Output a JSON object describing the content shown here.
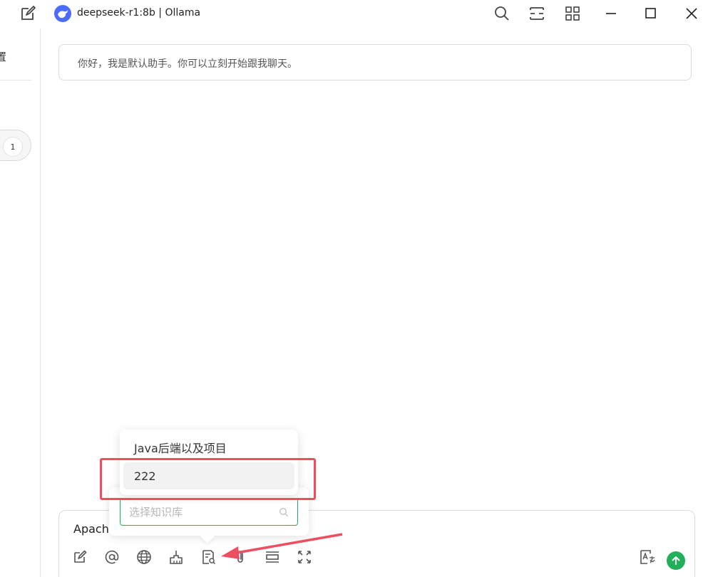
{
  "titlebar": {
    "title": "deepseek-r1:8b | Ollama",
    "icons": [
      "edit-icon",
      "deepseek-logo",
      "search-icon",
      "layout-icon",
      "grid-icon",
      "minimize-icon",
      "maximize-icon",
      "close-icon"
    ]
  },
  "sidebar": {
    "settings_label": "置",
    "badge_count": "1"
  },
  "chat": {
    "greeting": "你好，我是默认助手。你可以立刻开始跟我聊天。"
  },
  "input": {
    "value": "Apache"
  },
  "knowledge_popover": {
    "items": [
      {
        "label": "Java后端以及项目"
      },
      {
        "label": "222"
      }
    ],
    "search_placeholder": "选择知识库",
    "search_value": ""
  },
  "toolbar": {
    "tools": [
      "edit-icon",
      "mention-icon",
      "globe-icon",
      "clear-icon",
      "knowledge-icon",
      "attachment-icon",
      "expand-row-icon",
      "fullscreen-icon",
      "translate-icon"
    ]
  },
  "colors": {
    "accent": "#21b05a",
    "brand": "#4d6bfe",
    "annotation": "#ee4f60"
  }
}
